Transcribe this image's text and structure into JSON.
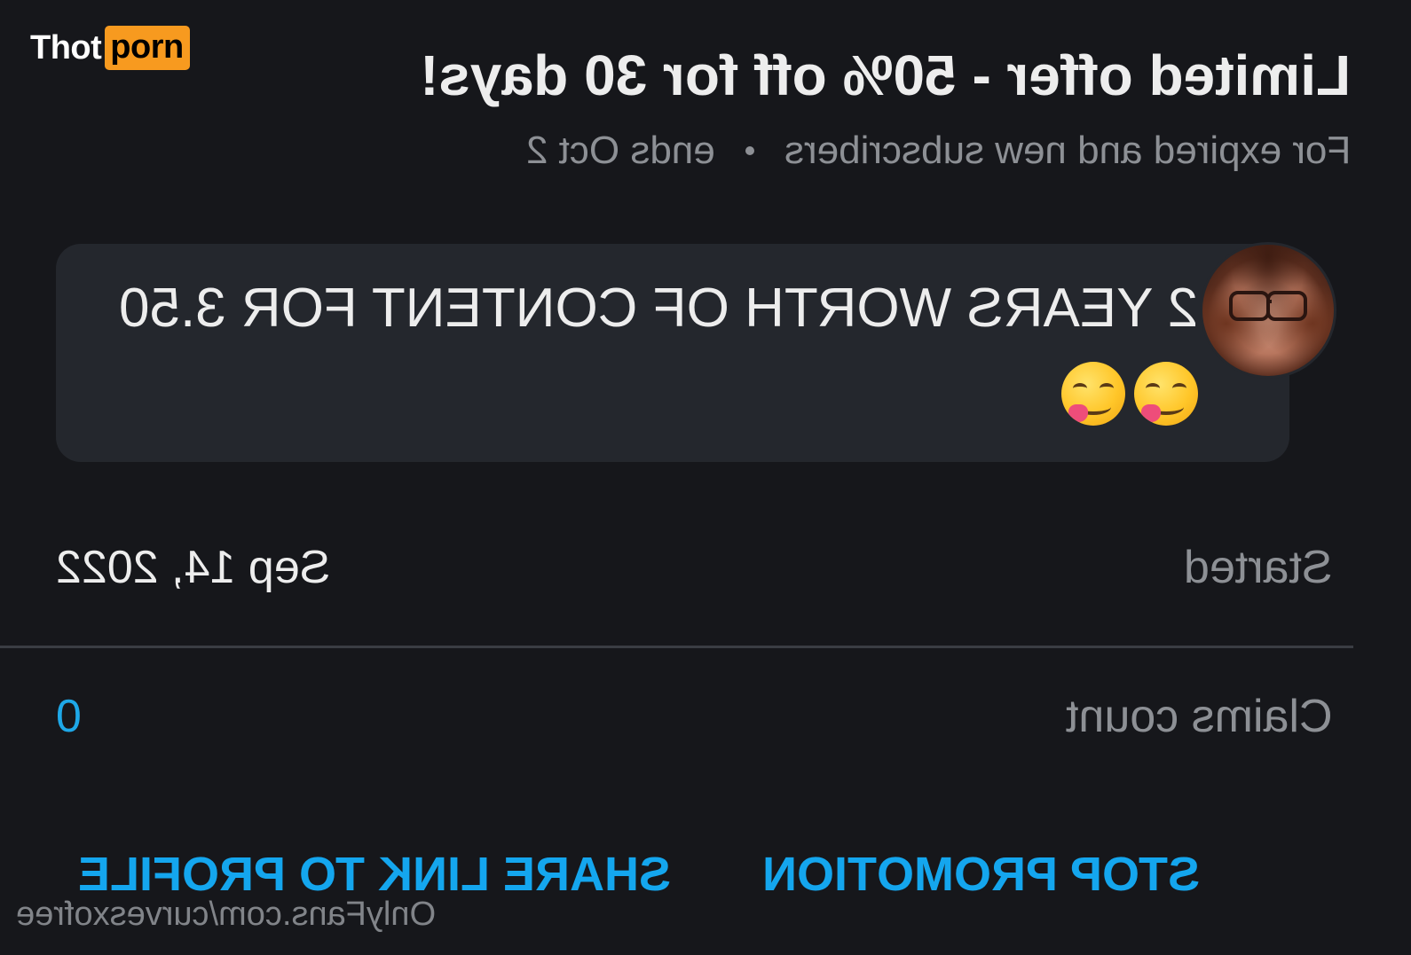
{
  "logo": {
    "left": "Thot",
    "right": "porn"
  },
  "offer": {
    "title": "Limited offer - 50% off for 30 days!",
    "audience": "For expired and new subscribers",
    "ends": "ends Oct 2"
  },
  "message": {
    "text": "2 YEARS WORTH OF CONTENT FOR 3.50",
    "emojis": [
      "face-savoring-food-emoji",
      "face-savoring-food-emoji"
    ]
  },
  "details": {
    "started_label": "Started",
    "started_value": "Sep 14, 2022",
    "claims_label": "Claims count",
    "claims_value": "0"
  },
  "actions": {
    "stop_label": "STOP PROMOTION",
    "share_label": "SHARE LINK TO PROFILE"
  },
  "watermark": "OnlyFans.com/curvesxofree",
  "colors": {
    "background": "#16171b",
    "bubble": "#24272d",
    "accent": "#14a6ee",
    "logo_badge": "#f79a1f",
    "muted_text": "#8d9095"
  }
}
